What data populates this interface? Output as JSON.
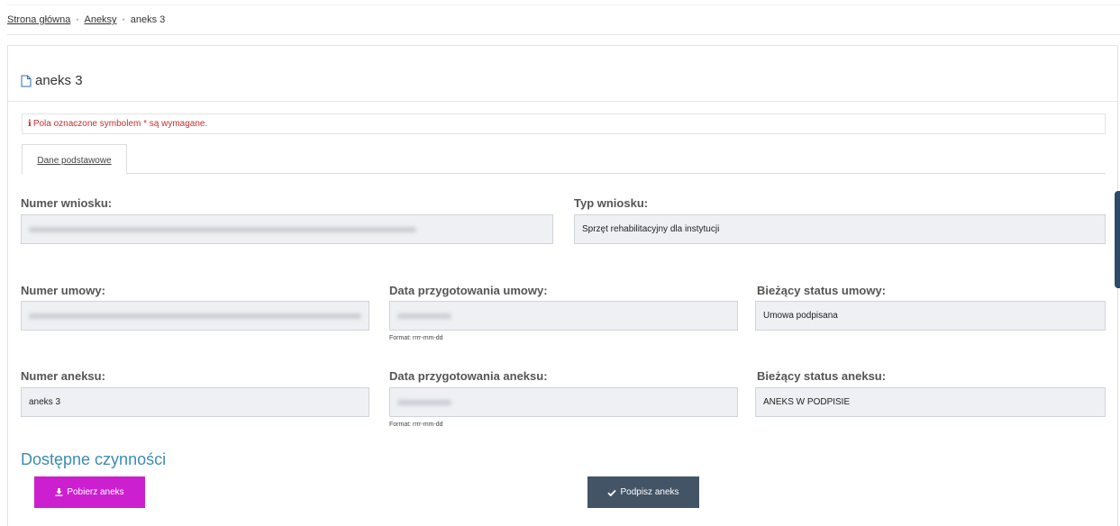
{
  "breadcrumb": {
    "home": "Strona główna",
    "annexes": "Aneksy",
    "current": "aneks 3"
  },
  "panel": {
    "title": "aneks 3",
    "required_note": "Pola oznaczone symbolem * są wymagane.",
    "tab_basic": "Dane podstawowe"
  },
  "fields": {
    "numer_wniosku": {
      "label": "Numer wniosku:",
      "value": ""
    },
    "typ_wniosku": {
      "label": "Typ wniosku:",
      "value": "Sprzęt rehabilitacyjny dla instytucji"
    },
    "numer_umowy": {
      "label": "Numer umowy:",
      "value": ""
    },
    "data_umowy": {
      "label": "Data przygotowania umowy:",
      "value": "",
      "hint": "Format: rrrr-mm-dd"
    },
    "status_umowy": {
      "label": "Bieżący status umowy:",
      "value": "Umowa podpisana"
    },
    "numer_aneksu": {
      "label": "Numer aneksu:",
      "value": "aneks 3"
    },
    "data_aneksu": {
      "label": "Data przygotowania aneksu:",
      "value": "",
      "hint": "Format: rrrr-mm-dd"
    },
    "status_aneksu": {
      "label": "Bieżący status aneksu:",
      "value": "ANEKS W PODPISIE"
    }
  },
  "actions": {
    "title": "Dostępne czynności",
    "download_label": "Pobierz aneks",
    "sign_label": "Podpisz aneks"
  },
  "colors": {
    "accent": "#3b8db1",
    "download_button": "#cc1fcf",
    "sign_button": "#435466",
    "required_text": "#c9302c"
  }
}
